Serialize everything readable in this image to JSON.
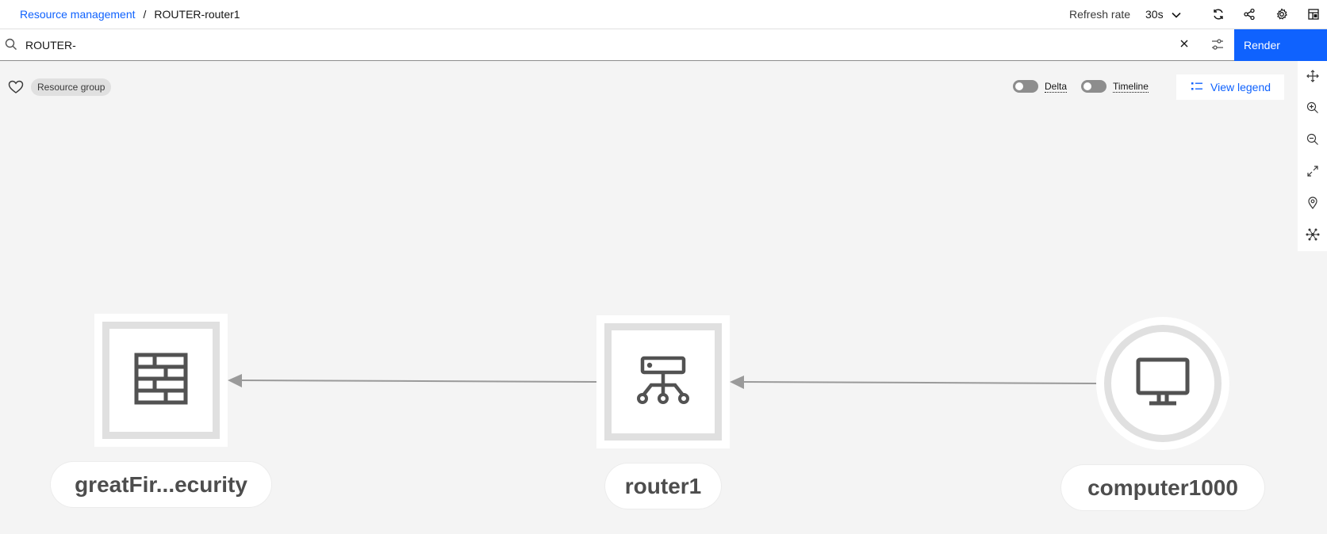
{
  "header": {
    "breadcrumb_link": "Resource management",
    "breadcrumb_sep": "/",
    "breadcrumb_current": "ROUTER-router1",
    "refresh_label": "Refresh rate",
    "refresh_value": "30s"
  },
  "search": {
    "value": "ROUTER-",
    "render_label": "Render"
  },
  "toolbar": {
    "chip_label": "Resource group",
    "delta_label": "Delta",
    "timeline_label": "Timeline",
    "legend_label": "View legend"
  },
  "graph": {
    "nodes": [
      {
        "label": "greatFir...ecurity",
        "icon": "firewall-icon"
      },
      {
        "label": "router1",
        "icon": "router-icon"
      },
      {
        "label": "computer1000",
        "icon": "desktop-icon"
      }
    ]
  },
  "colors": {
    "accent": "#0f62fe",
    "node_border": "#e0e0e0",
    "edge": "#9a9a9a",
    "canvas": "#f4f4f4"
  }
}
